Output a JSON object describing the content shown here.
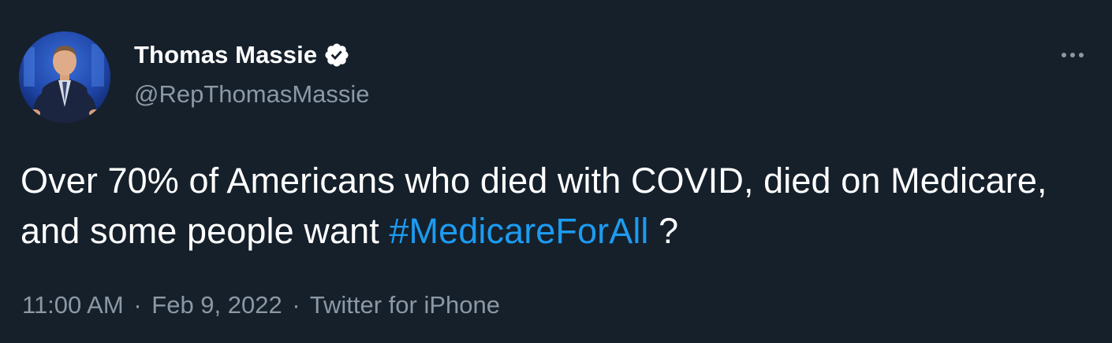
{
  "author": {
    "display_name": "Thomas Massie",
    "handle": "@RepThomasMassie",
    "verified": true
  },
  "tweet": {
    "text_before": "Over 70% of Americans who died with COVID, died on Medicare, and some people want ",
    "hashtag": "#MedicareForAll",
    "text_after": " ?"
  },
  "meta": {
    "time": "11:00 AM",
    "separator": "·",
    "date": "Feb 9, 2022",
    "source": "Twitter for iPhone"
  },
  "icons": {
    "avatar": "profile-photo",
    "verified": "verified-badge-icon",
    "more": "more-options-icon"
  },
  "colors": {
    "background": "#15202b",
    "text": "#ffffff",
    "secondary_text": "#8b98a5",
    "link": "#1d9bf0"
  }
}
